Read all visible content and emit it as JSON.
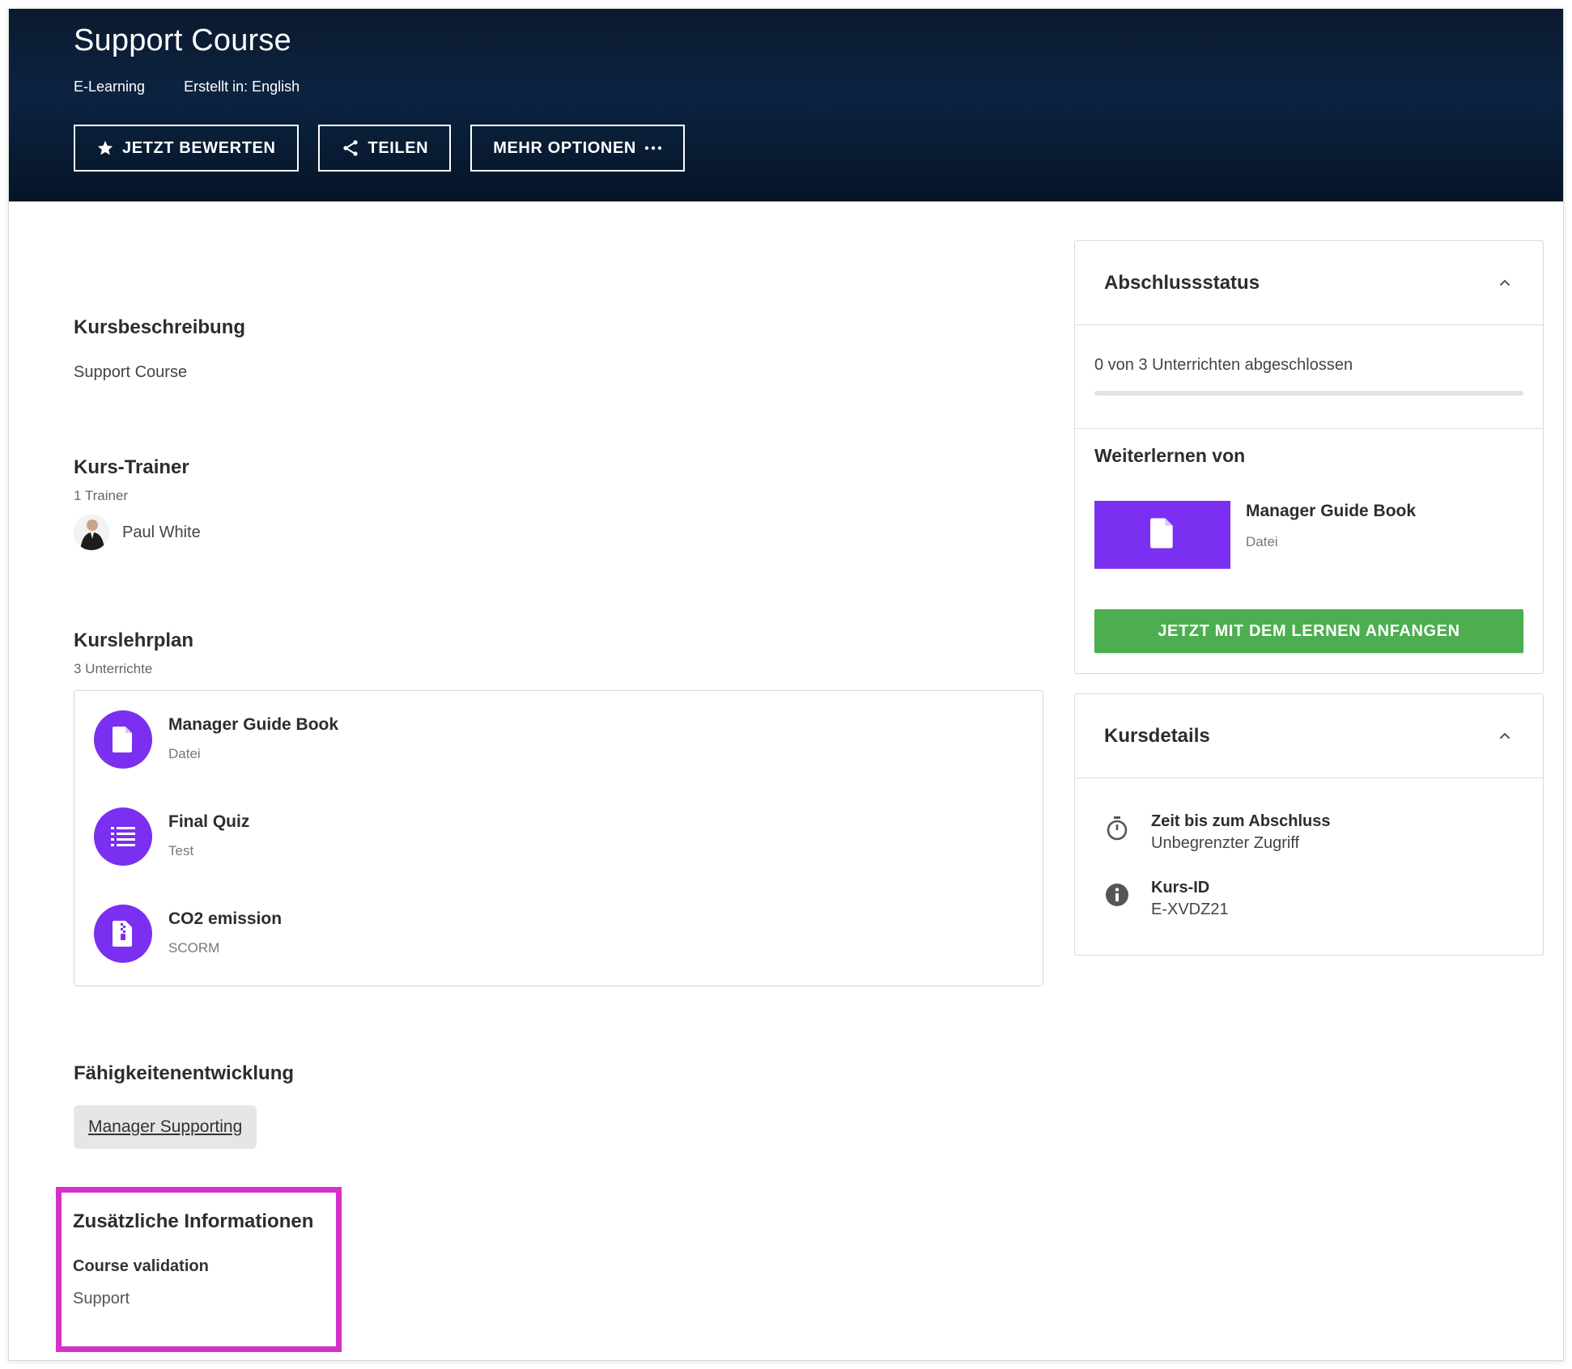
{
  "header": {
    "title": "Support Course",
    "type": "E-Learning",
    "created_in": "Erstellt in: English",
    "actions": {
      "rate_label": "JETZT BEWERTEN",
      "share_label": "TEILEN",
      "more_label": "MEHR OPTIONEN"
    }
  },
  "description": {
    "title": "Kursbeschreibung",
    "text": "Support Course"
  },
  "trainers": {
    "title": "Kurs-Trainer",
    "count": "1 Trainer",
    "items": [
      {
        "name": "Paul White"
      }
    ]
  },
  "curriculum": {
    "title": "Kurslehrplan",
    "count": "3 Unterrichte",
    "lessons": [
      {
        "title": "Manager Guide Book",
        "type": "Datei",
        "icon": "file-icon"
      },
      {
        "title": "Final Quiz",
        "type": "Test",
        "icon": "list-icon"
      },
      {
        "title": "CO2 emission",
        "type": "SCORM",
        "icon": "zip-file-icon"
      }
    ]
  },
  "skills": {
    "title": "Fähigkeitenentwicklung",
    "items": [
      "Manager Supporting"
    ]
  },
  "additional_info": {
    "title": "Zusätzliche Informationen",
    "label": "Course validation",
    "value": "Support",
    "highlight_color": "#d531c6"
  },
  "completion": {
    "title": "Abschlussstatus",
    "progress_text": "0 von 3 Unterrichten abgeschlossen",
    "progress_fraction": 0,
    "continue_title": "Weiterlernen von",
    "continue_item": {
      "title": "Manager Guide Book",
      "type": "Datei"
    },
    "start_label": "JETZT MIT DEM LERNEN ANFANGEN"
  },
  "details": {
    "title": "Kursdetails",
    "rows": [
      {
        "label": "Zeit bis zum Abschluss",
        "value": "Unbegrenzter Zugriff",
        "icon": "stopwatch-icon"
      },
      {
        "label": "Kurs-ID",
        "value": "E-XVDZ21",
        "icon": "info-icon"
      }
    ]
  },
  "colors": {
    "accent": "#7b2ff0",
    "start_button": "#4cae4f",
    "header_bg": "#0c2340"
  }
}
